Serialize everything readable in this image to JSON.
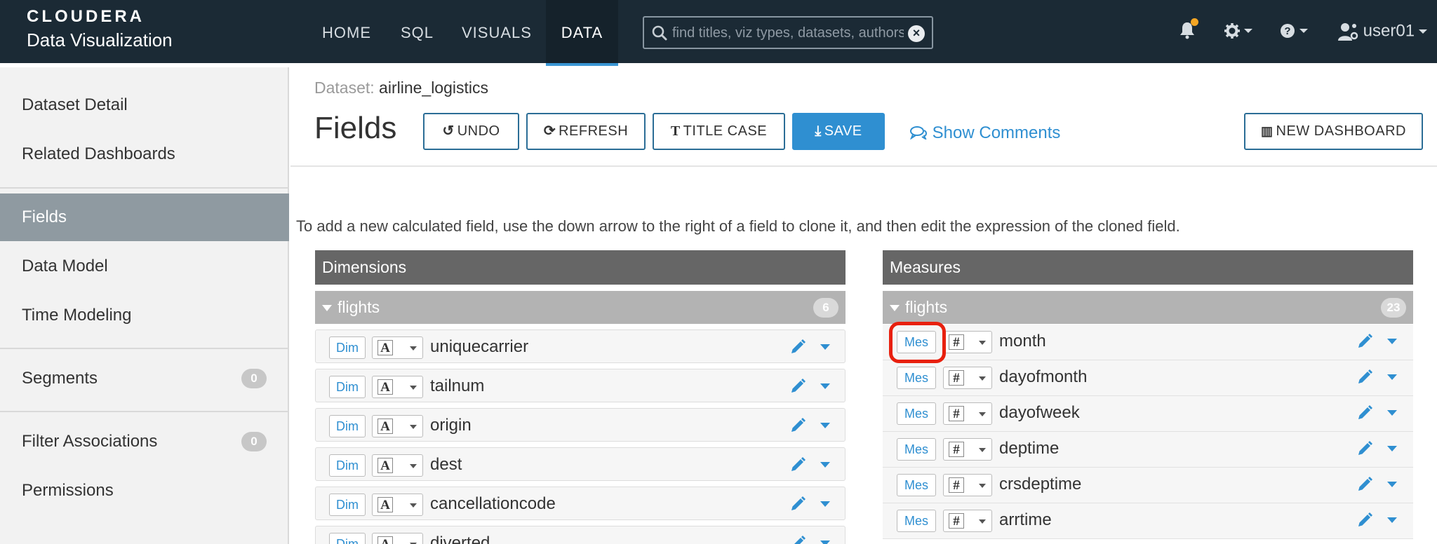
{
  "brand": {
    "line1": "CLOUDERA",
    "line2": "Data Visualization"
  },
  "nav": {
    "home": "HOME",
    "sql": "SQL",
    "visuals": "VISUALS",
    "data": "DATA"
  },
  "search": {
    "placeholder": "find titles, viz types, datasets, authors"
  },
  "user": {
    "name": "user01"
  },
  "sidebar": {
    "items": [
      {
        "label": "Dataset Detail"
      },
      {
        "label": "Related Dashboards"
      },
      {
        "label": "Fields"
      },
      {
        "label": "Data Model"
      },
      {
        "label": "Time Modeling"
      },
      {
        "label": "Segments",
        "badge": "0"
      },
      {
        "label": "Filter Associations",
        "badge": "0"
      },
      {
        "label": "Permissions"
      }
    ]
  },
  "header": {
    "dataset_label": "Dataset:",
    "dataset_name": "airline_logistics",
    "title": "Fields",
    "undo": "UNDO",
    "refresh": "REFRESH",
    "title_case": "TITLE CASE",
    "save": "SAVE",
    "show_comments": "Show Comments",
    "new_dashboard": "NEW DASHBOARD"
  },
  "hint": "To add a new calculated field, use the down arrow to the right of a field to clone it, and then edit the expression of the cloned field.",
  "dimensions": {
    "title": "Dimensions",
    "group": {
      "name": "flights",
      "count": "6"
    },
    "role": "Dim",
    "type_glyph": "A",
    "fields": [
      "uniquecarrier",
      "tailnum",
      "origin",
      "dest",
      "cancellationcode",
      "diverted"
    ]
  },
  "measures": {
    "title": "Measures",
    "group": {
      "name": "flights",
      "count": "23"
    },
    "role": "Mes",
    "type_glyph": "#",
    "fields": [
      "month",
      "dayofmonth",
      "dayofweek",
      "deptime",
      "crsdeptime",
      "arrtime"
    ]
  },
  "colors": {
    "nav_bg": "#1b2a35",
    "accent": "#2f8fd1",
    "highlight": "#e8200e",
    "panel_head": "#666666",
    "group_head": "#b3b3b3"
  }
}
